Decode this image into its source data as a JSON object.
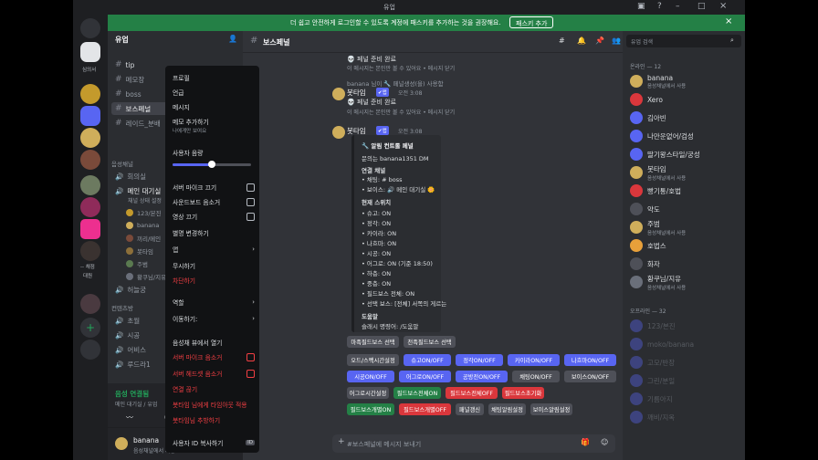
{
  "titlebar": {
    "title": "유업"
  },
  "banner": {
    "text": "더 쉽고 안전하게 로그인할 수 있도록 계정에 패스키를 추가하는 것을 권장해요.",
    "button": "패스키 추가"
  },
  "server": {
    "name": "유업"
  },
  "channels": [
    {
      "name": "tip",
      "type": "text"
    },
    {
      "name": "메모장",
      "type": "text"
    },
    {
      "name": "boss",
      "type": "text"
    },
    {
      "name": "보스페널",
      "type": "text",
      "active": true
    },
    {
      "name": "레이드_분배",
      "type": "text"
    }
  ],
  "voice_category": "음성채널",
  "voice": [
    {
      "name": "회의실",
      "users": []
    },
    {
      "name": "메인 대기실",
      "sub": "채널 상태 설정",
      "users": [
        "123/본진",
        "banana",
        "끼리/메인",
        "봇타임",
        "주범",
        "황쿠님/지유"
      ]
    },
    {
      "name": "허늘궁",
      "users": []
    }
  ],
  "content_category": "컨텐츠방",
  "content_channels": [
    "초월",
    "시공",
    "어비스",
    "루드라1"
  ],
  "server_labels": {
    "s1": "심의서",
    "s2": "-- 채점",
    "s3": "대원"
  },
  "voice_connected": {
    "status": "음성 연결됨",
    "channel": "메인 대기실 / 유업"
  },
  "user": {
    "name": "banana",
    "status": "음성채널에서 사용"
  },
  "chat": {
    "channel": "보스페널",
    "search_placeholder": "유업 검색",
    "top_msg": "💀 페널 준비 완료",
    "only_you": "이 메시지는 본인만 볼 수 있어요 • 메시지 닫기",
    "system": "banana 님이 🔧 페널생성(을) 사용함",
    "bot_name": "봇타임",
    "bot_tag": "✔앱",
    "time": "오전 3:08",
    "msg": "💀 페널 준비 완료",
    "embed": {
      "title": "🔧 알림 컨트롤 페널",
      "inquiry": "문의는 banana1351 DM",
      "linked": "연결 채널",
      "ch1": "• 채팅: # boss",
      "ch2": "• 보이스: 🔊 메인 대기실 🌼",
      "switch": "현재 스위치",
      "items": [
        "• 슈고: ON",
        "• 정각: ON",
        "• 카이라: ON",
        "• 나흐마: ON",
        "• 시공: ON",
        "• 어그로: ON (기준 18:50)",
        "• 하층: ON",
        "• 중층: ON",
        "• 필드보스 전체: ON",
        "• 선택 보스: [전체] 서쪽의 게르는"
      ],
      "help": "도움말",
      "help2": "슬래시 명령어: /도움말"
    },
    "input_placeholder": "#보스페널에 메시지 보내기"
  },
  "buttons": [
    [
      {
        "l": "마족필드보스 선택",
        "c": "g"
      },
      {
        "l": "천족필드보스 선택",
        "c": "g"
      }
    ],
    [
      {
        "l": "오드/스펙시간설정",
        "c": "g"
      },
      {
        "l": "슈고ON/OFF",
        "c": "b"
      },
      {
        "l": "정각ON/OFF",
        "c": "b"
      },
      {
        "l": "카이라ON/OFF",
        "c": "b"
      },
      {
        "l": "나흐마ON/OFF",
        "c": "b"
      }
    ],
    [
      {
        "l": "시공ON/OFF",
        "c": "b"
      },
      {
        "l": "어그로ON/OFF",
        "c": "b"
      },
      {
        "l": "공방전ON/OFF",
        "c": "b"
      },
      {
        "l": "채팅ON/OFF",
        "c": "g"
      },
      {
        "l": "보이스ON/OFF",
        "c": "g"
      }
    ],
    [
      {
        "l": "어그로시간설정",
        "c": "g"
      },
      {
        "l": "필드보스전체ON",
        "c": "gr"
      },
      {
        "l": "필드보스전체OFF",
        "c": "r"
      },
      {
        "l": "필드보스초기화",
        "c": "r"
      }
    ],
    [
      {
        "l": "필드보스개별ON",
        "c": "gr"
      },
      {
        "l": "필드보스개별OFF",
        "c": "r"
      },
      {
        "l": "패널갱신",
        "c": "g"
      },
      {
        "l": "채팅알림설정",
        "c": "g"
      },
      {
        "l": "보이스알림설정",
        "c": "g"
      }
    ]
  ],
  "menu": {
    "items": [
      "프로필",
      "언급",
      "메시지",
      "메모 추가하기"
    ],
    "memo_sub": "나에게만 보여요",
    "volume": "사용자 음량",
    "volume_level": 0.5,
    "checks": [
      "서버 마이크 끄기",
      "사운드보드 음소거",
      "영상 끄기"
    ],
    "more": [
      "별명 변경하기",
      "앱",
      "무시하기"
    ],
    "block": "차단하기",
    "sub": [
      "역할",
      "이동하기:"
    ],
    "open": "음성채 뷰에서 열기",
    "red_checks": [
      "서버 마이크 음소거",
      "서버 헤드셋 음소거"
    ],
    "kick": "연결 끊기",
    "timeout": "봇타임 님에게 타임아웃 적용",
    "ban": "봇타임님 추방하기",
    "copy": "사용자 ID 복사하기"
  },
  "members": {
    "online_header": "온라인 — 12",
    "online": [
      {
        "n": "banana",
        "s": "음성채널에서 사용"
      },
      {
        "n": "Xero",
        "s": ""
      },
      {
        "n": "김아빈",
        "s": ""
      },
      {
        "n": "나만운없어/검성",
        "s": ""
      },
      {
        "n": "딸기왕스타일/궁성",
        "s": ""
      },
      {
        "n": "봇타임",
        "s": "음성채널에서 사용"
      },
      {
        "n": "빵기통/호법",
        "s": ""
      },
      {
        "n": "약도",
        "s": ""
      },
      {
        "n": "주범",
        "s": "음성채널에서 사용"
      },
      {
        "n": "호법스",
        "s": ""
      },
      {
        "n": "화자",
        "s": ""
      },
      {
        "n": "황쿠님/지유",
        "s": "음성채널에서 사용"
      }
    ],
    "offline_header": "오프라인 — 32",
    "offline": [
      "123/본진",
      "moko/banana",
      "고모/반장",
      "그린/분일",
      "기름아지",
      "깨비/지옥"
    ]
  },
  "colors": {
    "accent": "#5865f2",
    "green": "#248046",
    "red": "#da373c"
  }
}
